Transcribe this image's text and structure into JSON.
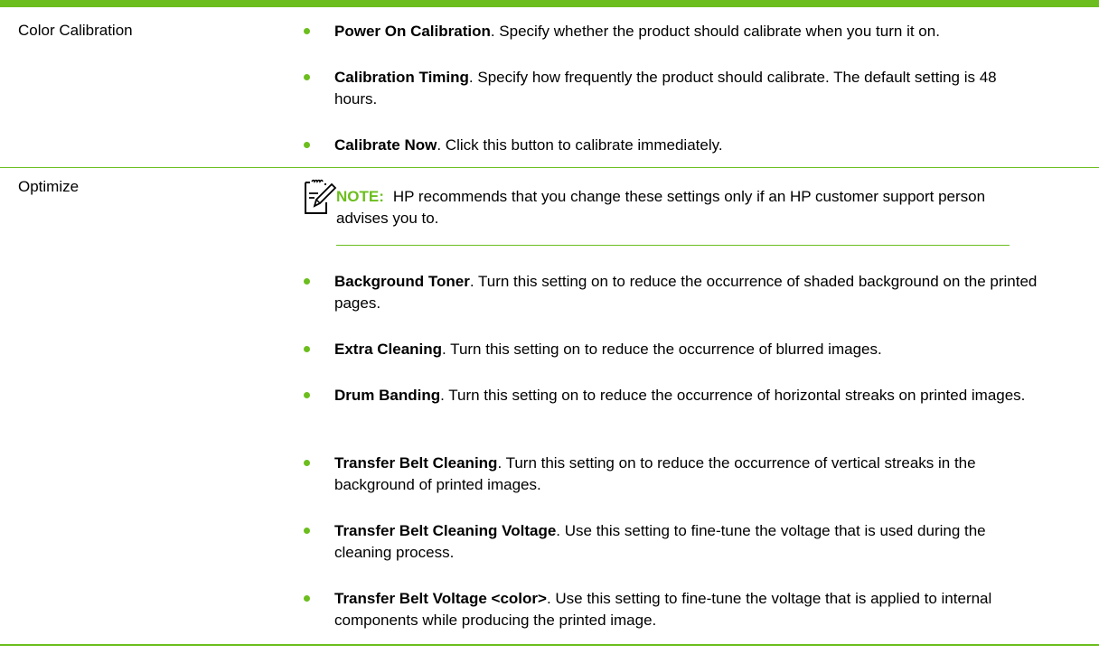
{
  "table": {
    "rows": [
      {
        "label": "Color Calibration",
        "items": [
          {
            "title": "Power On Calibration",
            "text": ". Specify whether the product should calibrate when you turn it on."
          },
          {
            "title": "Calibration Timing",
            "text": ". Specify how frequently the product should calibrate. The default setting is 48 hours."
          },
          {
            "title": "Calibrate Now",
            "text": ". Click this button to calibrate immediately."
          }
        ]
      },
      {
        "label": "Optimize",
        "note": {
          "label": "NOTE:",
          "text": "HP recommends that you change these settings only if an HP customer support person advises you to."
        },
        "items": [
          {
            "title": "Background Toner",
            "text": ". Turn this setting on to reduce the occurrence of shaded background on the printed pages."
          },
          {
            "title": "Extra Cleaning",
            "text": ". Turn this setting on to reduce the occurrence of blurred images."
          },
          {
            "title": "Drum Banding",
            "text": ". Turn this setting on to reduce the occurrence of horizontal streaks on printed images."
          },
          {
            "title": "Transfer Belt Cleaning",
            "text": ". Turn this setting on to reduce the occurrence of vertical streaks in the background of printed images."
          },
          {
            "title": "Transfer Belt Cleaning Voltage",
            "text": ". Use this setting to fine-tune the voltage that is used during the cleaning process."
          },
          {
            "title": "Transfer Belt Voltage <color>",
            "text": ". Use this setting to fine-tune the voltage that is applied to internal components while producing the printed image."
          }
        ]
      }
    ]
  },
  "icons": {
    "note": "note-pencil-icon",
    "bullet": "bullet-dot-icon"
  },
  "colors": {
    "accent": "#6cbe1e",
    "text": "#000000"
  }
}
